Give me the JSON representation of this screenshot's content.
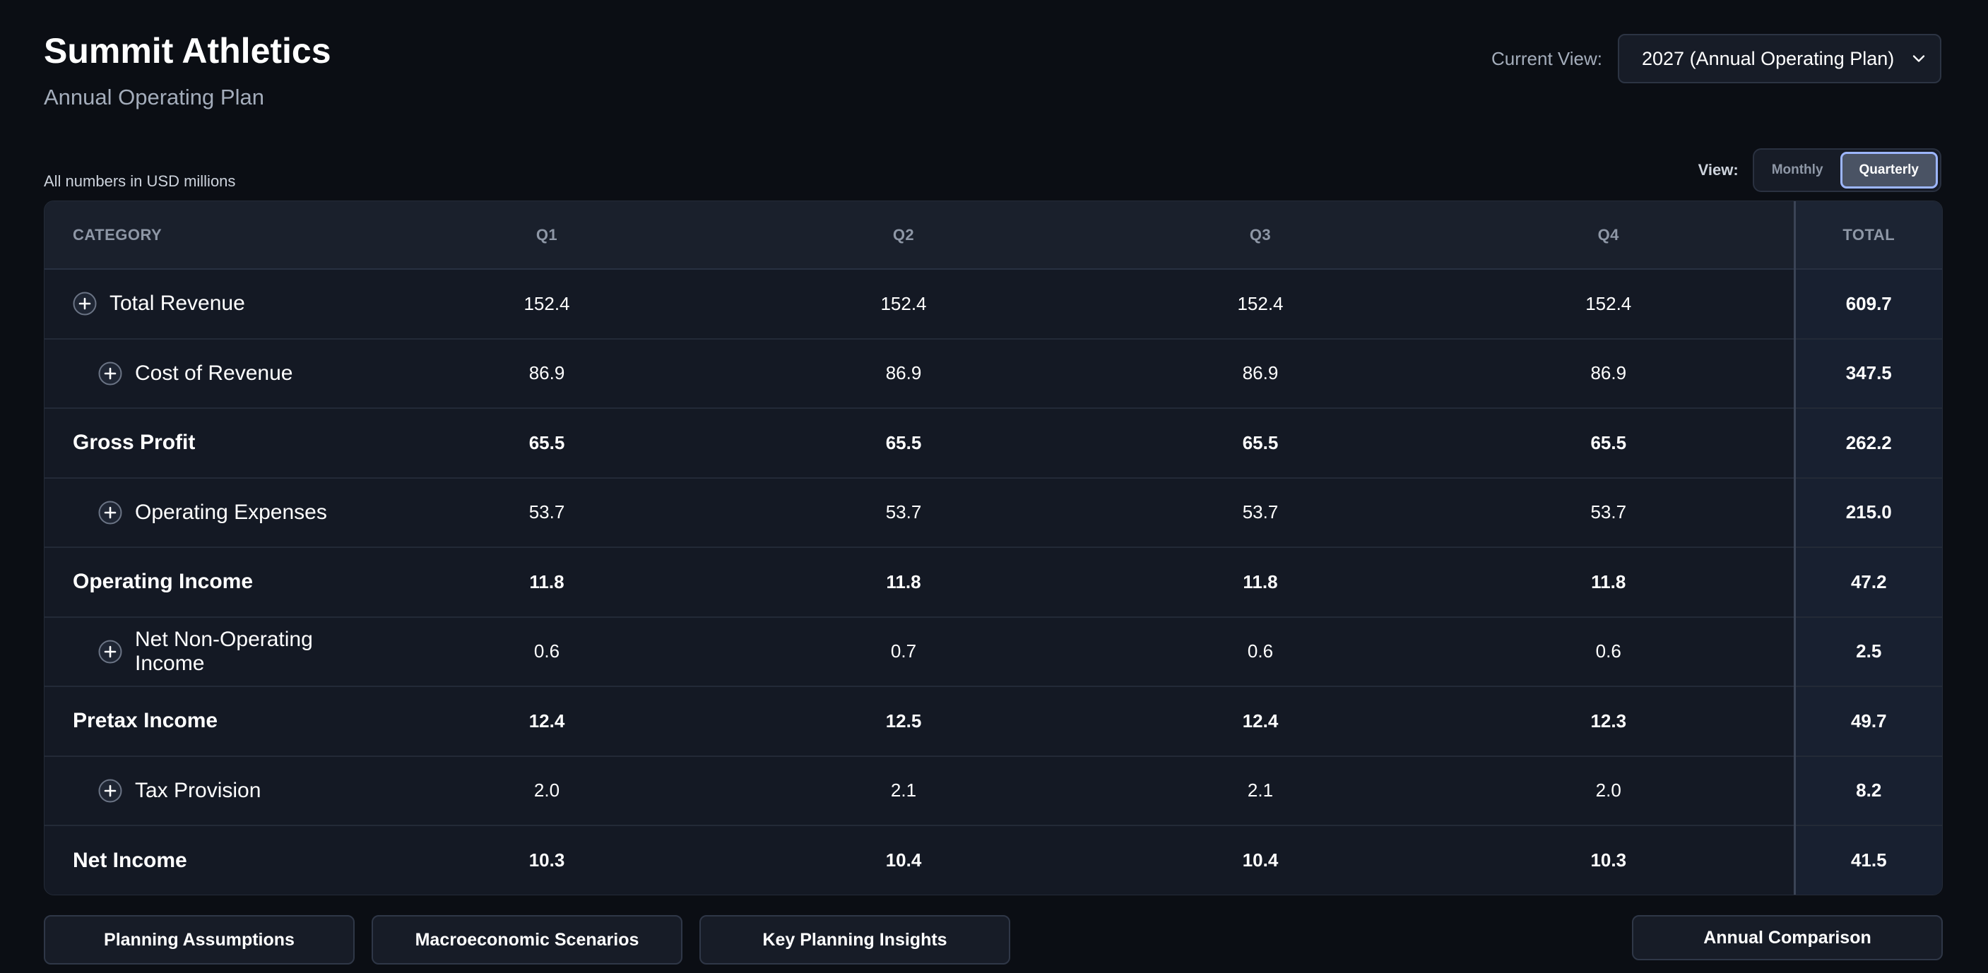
{
  "header": {
    "title": "Summit Athletics",
    "subtitle": "Annual Operating Plan",
    "current_view_label": "Current View:",
    "current_view_value": "2027 (Annual Operating Plan)"
  },
  "units_note": "All numbers in USD millions",
  "view_toggle": {
    "label": "View:",
    "options": [
      "Monthly",
      "Quarterly"
    ],
    "selected": "Quarterly"
  },
  "table": {
    "columns": [
      "CATEGORY",
      "Q1",
      "Q2",
      "Q3",
      "Q4",
      "TOTAL"
    ],
    "rows": [
      {
        "category": "Total Revenue",
        "values": [
          "152.4",
          "152.4",
          "152.4",
          "152.4"
        ],
        "total": "609.7"
      },
      {
        "category": "Cost of Revenue",
        "values": [
          "86.9",
          "86.9",
          "86.9",
          "86.9"
        ],
        "total": "347.5"
      },
      {
        "category": "Gross Profit",
        "values": [
          "65.5",
          "65.5",
          "65.5",
          "65.5"
        ],
        "total": "262.2"
      },
      {
        "category": "Operating Expenses",
        "values": [
          "53.7",
          "53.7",
          "53.7",
          "53.7"
        ],
        "total": "215.0"
      },
      {
        "category": "Operating Income",
        "values": [
          "11.8",
          "11.8",
          "11.8",
          "11.8"
        ],
        "total": "47.2"
      },
      {
        "category": "Net Non-Operating Income",
        "values": [
          "0.6",
          "0.7",
          "0.6",
          "0.6"
        ],
        "total": "2.5"
      },
      {
        "category": "Pretax Income",
        "values": [
          "12.4",
          "12.5",
          "12.4",
          "12.3"
        ],
        "total": "49.7"
      },
      {
        "category": "Tax Provision",
        "values": [
          "2.0",
          "2.1",
          "2.1",
          "2.0"
        ],
        "total": "8.2"
      },
      {
        "category": "Net Income",
        "values": [
          "10.3",
          "10.4",
          "10.4",
          "10.3"
        ],
        "total": "41.5"
      }
    ]
  },
  "footer": {
    "planning_assumptions": "Planning Assumptions",
    "macro_scenarios": "Macroeconomic Scenarios",
    "key_insights": "Key Planning Insights",
    "annual_comparison": "Annual Comparison"
  }
}
